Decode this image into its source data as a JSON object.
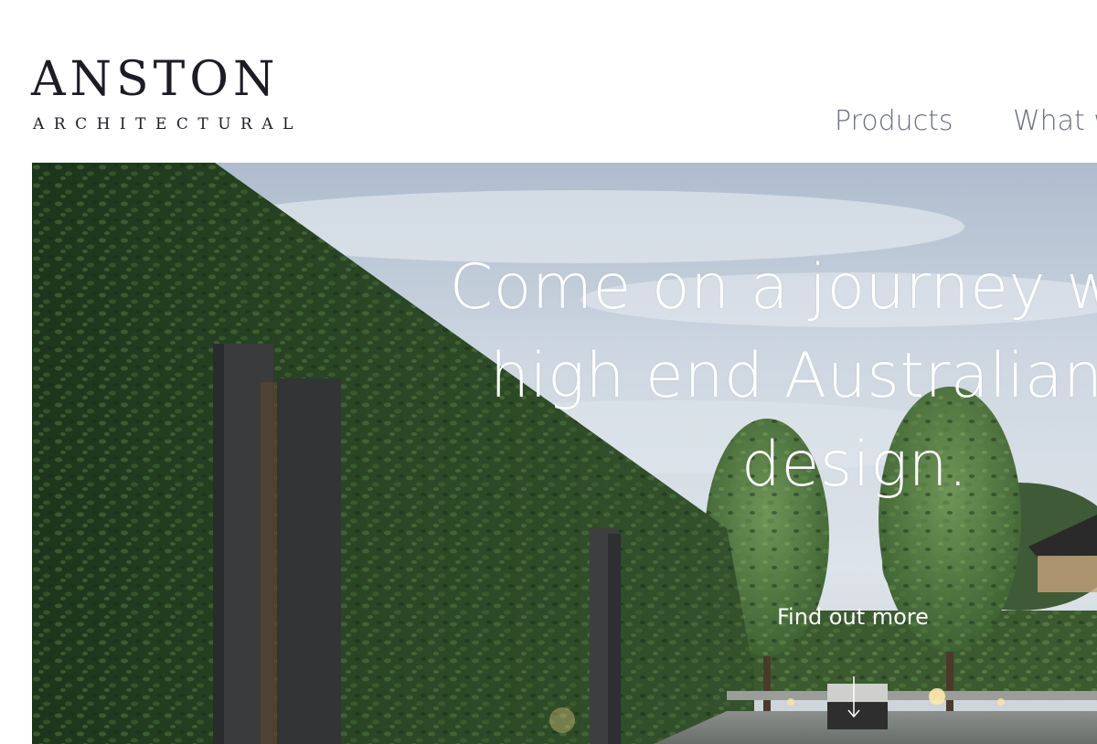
{
  "header": {
    "logo_main": "ANSTON",
    "logo_sub": "ARCHITECTURAL",
    "nav": {
      "products": "Products",
      "what": "What w"
    }
  },
  "hero": {
    "headline": "Come on a journey with u\nhigh end Australian lan\ndesign.",
    "cta": "Find out more",
    "scroll_icon": "arrow-down-icon"
  },
  "colors": {
    "logo_text": "#1c1c24",
    "nav_text": "#6b6f80",
    "hero_text": "#ffffff"
  }
}
